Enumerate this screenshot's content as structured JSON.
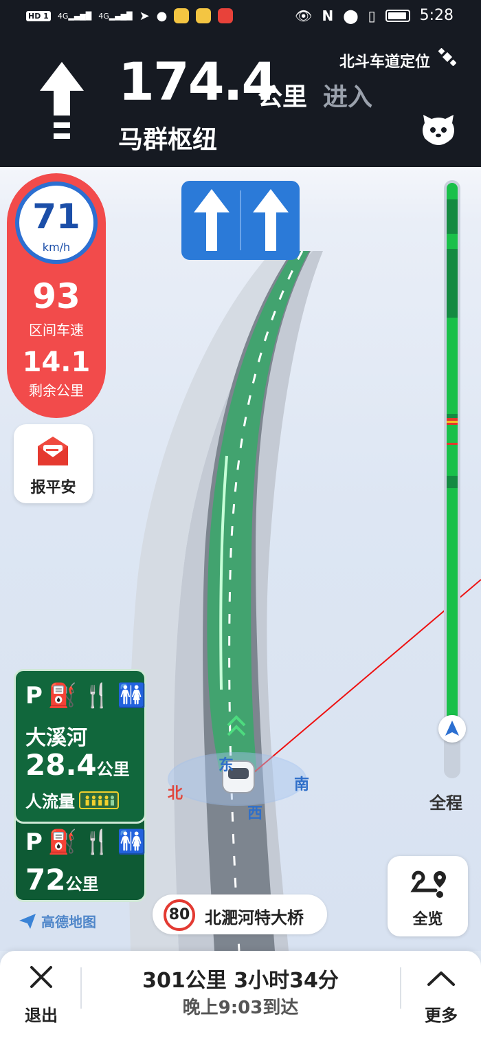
{
  "status_bar": {
    "network_chip": "HD 1",
    "signal_1": "4G",
    "signal_2": "4G",
    "time": "5:28"
  },
  "guidance": {
    "distance": "174.4",
    "distance_unit": "公里",
    "action": "进入",
    "road": "马群枢纽",
    "beidou": "北斗车道定位"
  },
  "speed_panel": {
    "current_speed": "71",
    "speed_unit": "km/h",
    "average_speed": "93",
    "average_label": "区间车速",
    "remaining": "14.1",
    "remaining_label": "剩余公里"
  },
  "report_safe": {
    "label": "报平安"
  },
  "progress": {
    "label": "全程",
    "fraction_remaining": 0.9
  },
  "service_areas": [
    {
      "name": "大溪河",
      "distance": "28.4",
      "unit": "公里",
      "flow_label": "人流量"
    },
    {
      "distance": "72",
      "unit": "公里"
    }
  ],
  "compass": {
    "north": "北",
    "east": "东",
    "south": "南",
    "west": "西"
  },
  "brand": {
    "logo_text": "高德地图"
  },
  "current_road": {
    "speed_limit": "80",
    "name": "北淝河特大桥"
  },
  "overview": {
    "label": "全览"
  },
  "bottom_bar": {
    "exit_label": "退出",
    "summary": "301公里 3小时34分",
    "arrival": "晚上9:03到达",
    "more_label": "更多"
  },
  "colors": {
    "header_bg": "#161a22",
    "speed_panel": "#f24b4b",
    "route_green": "#19c04a",
    "lane_blue": "#2b7ad8",
    "service_green": "#11673c"
  }
}
